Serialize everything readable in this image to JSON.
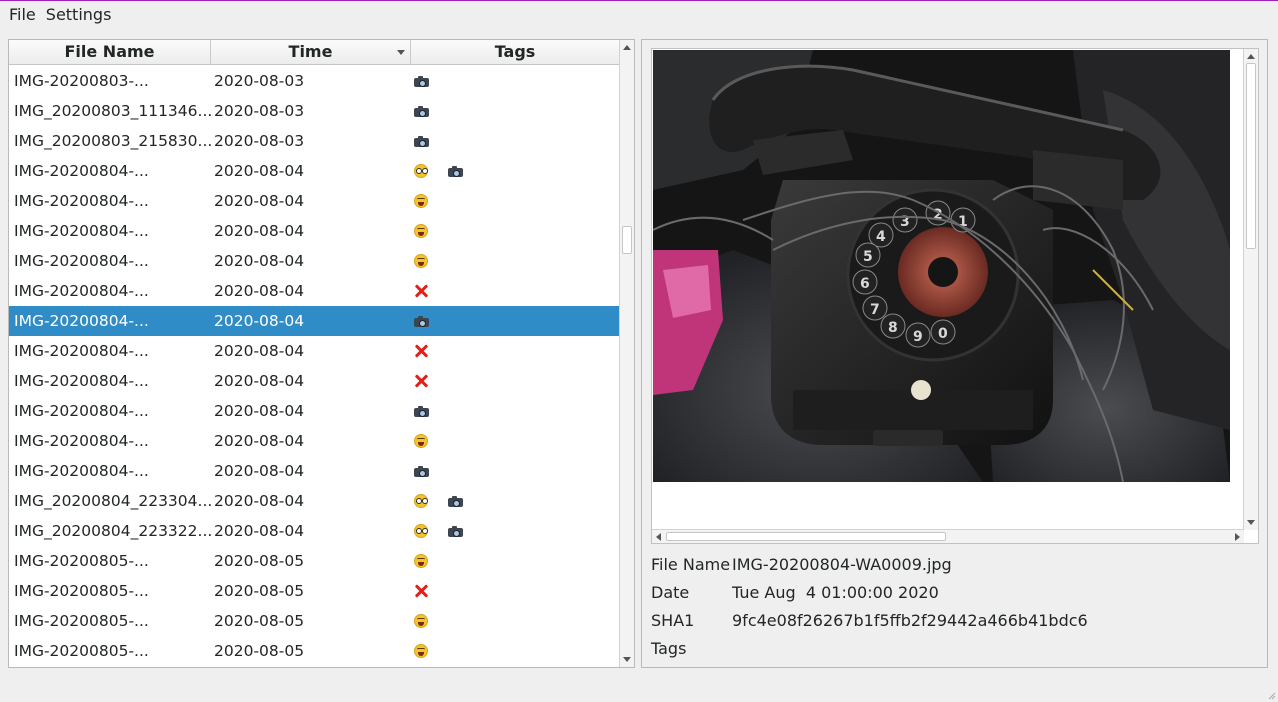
{
  "menu": {
    "file": "File",
    "settings": "Settings"
  },
  "table": {
    "headers": {
      "name": "File Name",
      "time": "Time",
      "tags": "Tags"
    },
    "rows": [
      {
        "name": "IMG-20200803-...",
        "time": "2020-08-03",
        "tags": [
          "camera-icon"
        ]
      },
      {
        "name": "IMG_20200803_111346....",
        "time": "2020-08-03",
        "tags": [
          "camera-icon"
        ]
      },
      {
        "name": "IMG_20200803_215830....",
        "time": "2020-08-03",
        "tags": [
          "camera-icon"
        ]
      },
      {
        "name": "IMG-20200804-...",
        "time": "2020-08-04",
        "tags": [
          "nerd-face-icon",
          "camera-icon"
        ]
      },
      {
        "name": "IMG-20200804-...",
        "time": "2020-08-04",
        "tags": [
          "laughing-face-icon"
        ]
      },
      {
        "name": "IMG-20200804-...",
        "time": "2020-08-04",
        "tags": [
          "laughing-face-icon"
        ]
      },
      {
        "name": "IMG-20200804-...",
        "time": "2020-08-04",
        "tags": [
          "laughing-face-icon"
        ]
      },
      {
        "name": "IMG-20200804-...",
        "time": "2020-08-04",
        "tags": [
          "red-cross-icon"
        ]
      },
      {
        "name": "IMG-20200804-...",
        "time": "2020-08-04",
        "tags": [
          "camera-icon"
        ],
        "selected": true
      },
      {
        "name": "IMG-20200804-...",
        "time": "2020-08-04",
        "tags": [
          "red-cross-icon"
        ]
      },
      {
        "name": "IMG-20200804-...",
        "time": "2020-08-04",
        "tags": [
          "red-cross-icon"
        ]
      },
      {
        "name": "IMG-20200804-...",
        "time": "2020-08-04",
        "tags": [
          "camera-icon"
        ]
      },
      {
        "name": "IMG-20200804-...",
        "time": "2020-08-04",
        "tags": [
          "laughing-face-icon"
        ]
      },
      {
        "name": "IMG-20200804-...",
        "time": "2020-08-04",
        "tags": [
          "camera-icon"
        ]
      },
      {
        "name": "IMG_20200804_223304....",
        "time": "2020-08-04",
        "tags": [
          "nerd-face-icon",
          "camera-icon"
        ]
      },
      {
        "name": "IMG_20200804_223322....",
        "time": "2020-08-04",
        "tags": [
          "nerd-face-icon",
          "camera-icon"
        ]
      },
      {
        "name": "IMG-20200805-...",
        "time": "2020-08-05",
        "tags": [
          "laughing-face-icon"
        ]
      },
      {
        "name": "IMG-20200805-...",
        "time": "2020-08-05",
        "tags": [
          "red-cross-icon"
        ]
      },
      {
        "name": "IMG-20200805-...",
        "time": "2020-08-05",
        "tags": [
          "laughing-face-icon"
        ]
      },
      {
        "name": "IMG-20200805-...",
        "time": "2020-08-05",
        "tags": [
          "laughing-face-icon"
        ]
      }
    ]
  },
  "details": {
    "file_name_label": "File Name",
    "file_name_value": "IMG-20200804-WA0009.jpg",
    "date_label": "Date",
    "date_value": "Tue Aug  4 01:00:00 2020",
    "sha1_label": "SHA1",
    "sha1_value": "9fc4e08f26267b1f5ffb2f29442a466b41bdc6",
    "tags_label": "Tags",
    "tags_value": ""
  },
  "colors": {
    "selection": "#308cc6",
    "window_border": "#a020c0",
    "cross": "#e0201a"
  }
}
